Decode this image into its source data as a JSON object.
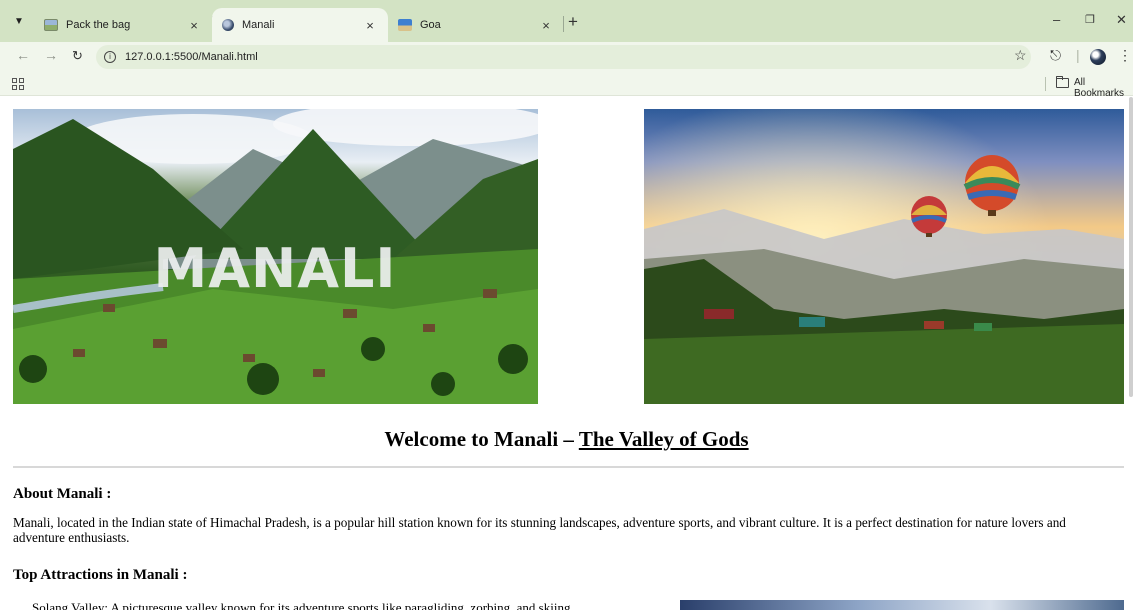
{
  "browser": {
    "tabs": [
      {
        "title": "Pack the bag",
        "active": false
      },
      {
        "title": "Manali",
        "active": true
      },
      {
        "title": "Goa",
        "active": false
      }
    ],
    "url": "127.0.0.1:5500/Manali.html",
    "bookmarks_label": "All Bookmarks",
    "icons": {
      "tab_search": "chevron-down-icon",
      "back": "arrow-left-icon",
      "forward": "arrow-right-icon",
      "reload": "reload-icon",
      "site_info": "info-icon",
      "bookmark": "star-icon",
      "extensions": "puzzle-icon",
      "menu": "kebab-icon",
      "apps": "apps-grid-icon",
      "folder": "folder-icon"
    }
  },
  "page": {
    "hero_left_text": "MANALI",
    "welcome_prefix": "Welcome to Manali – ",
    "welcome_link": "The Valley of Gods",
    "about_heading": "About Manali :",
    "about_text": "Manali, located in the Indian state of Himachal Pradesh, is a popular hill station known for its stunning landscapes, adventure sports, and vibrant culture. It is a perfect destination for nature lovers and adventure enthusiasts.",
    "attractions_heading": "Top Attractions in Manali :",
    "attractions": [
      "Solang Valley: A picturesque valley known for its adventure sports like paragliding, zorbing, and skiing."
    ]
  }
}
